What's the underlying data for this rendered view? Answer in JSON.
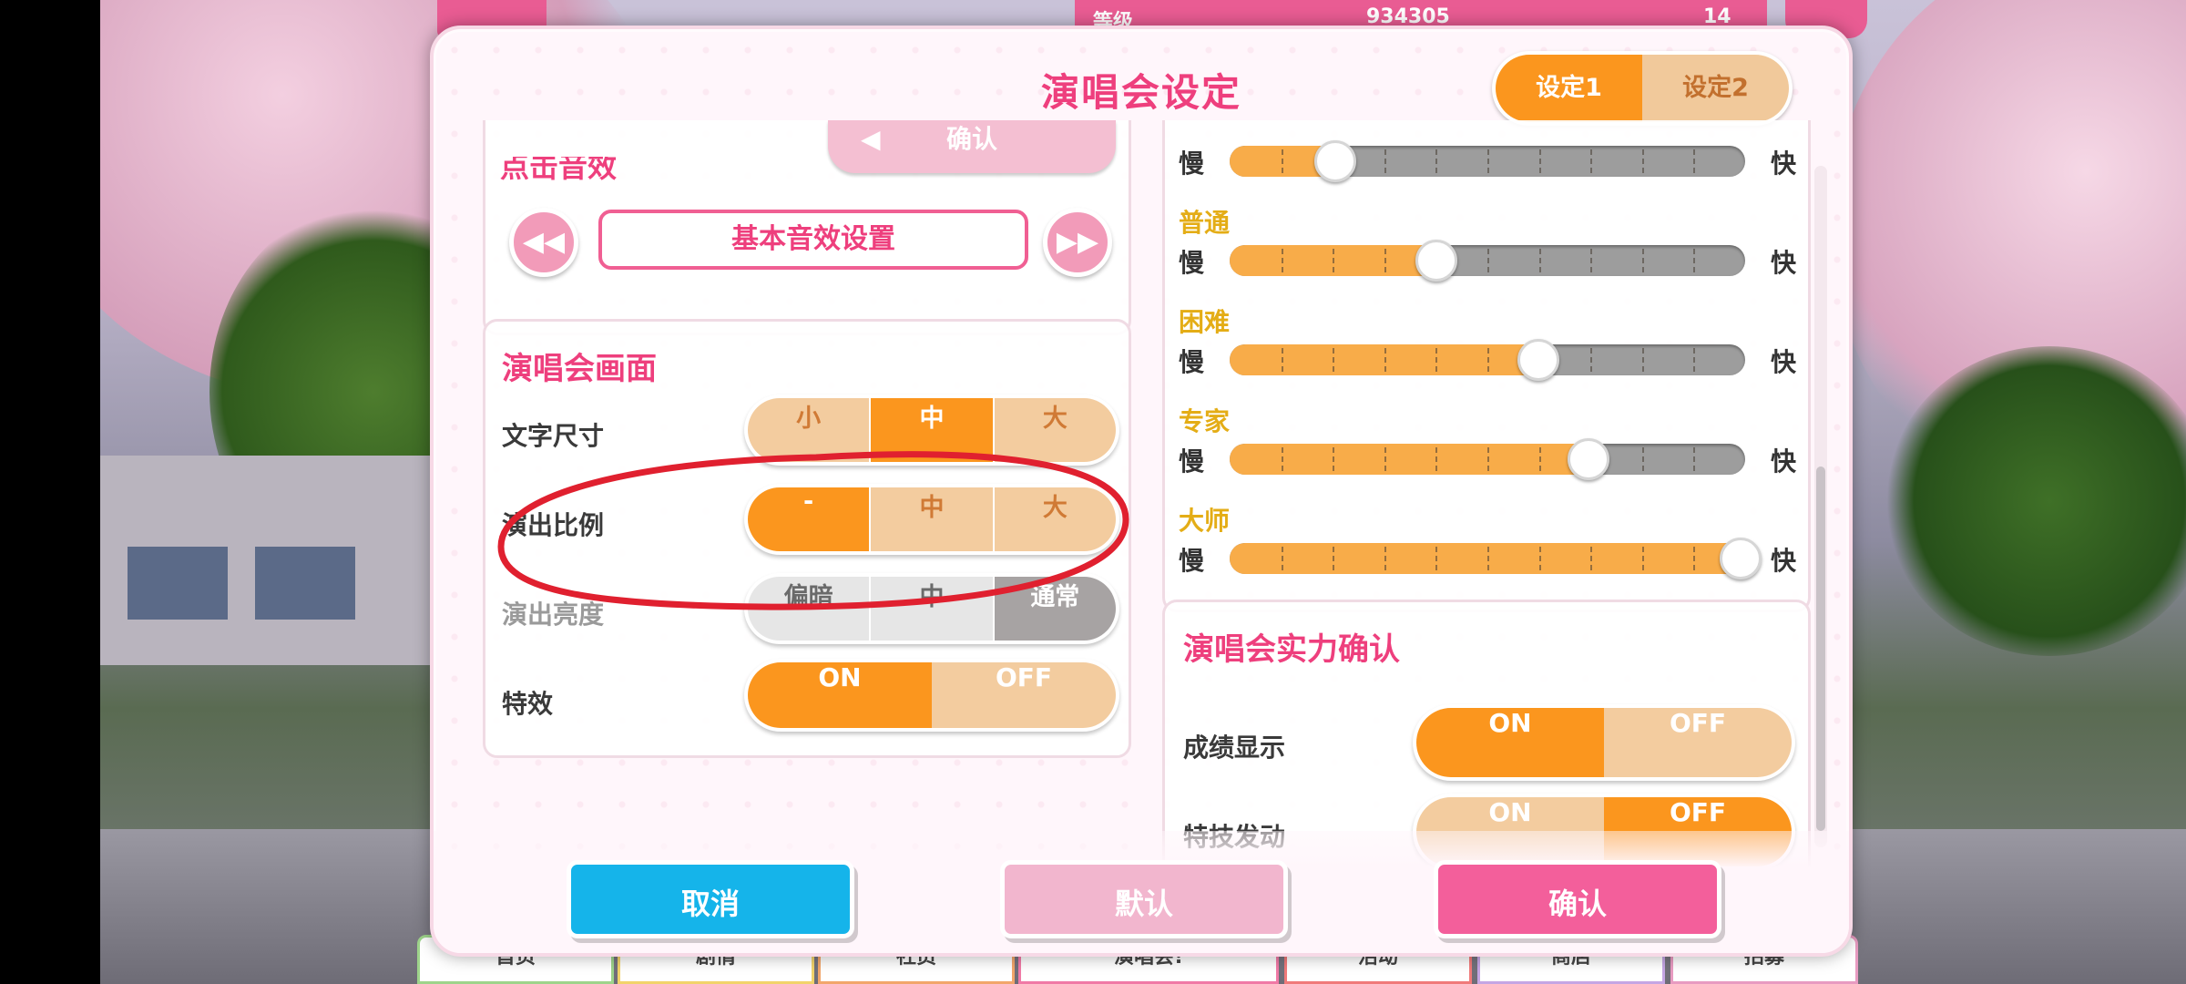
{
  "background_bar": {
    "rank_label": "等级",
    "score": "934305",
    "hearts": "14"
  },
  "bottom_tabs": [
    "首页",
    "剧情",
    "社员",
    "演唱会!",
    "活动",
    "商店",
    "招募"
  ],
  "dialog": {
    "title": "演唱会设定",
    "tabs": [
      {
        "label": "设定1",
        "selected": true
      },
      {
        "label": "设定2",
        "selected": false
      }
    ],
    "sound_section": {
      "tap_sound_label": "点击音效",
      "confirm_button": "确认",
      "basic_sound_button": "基本音效设置",
      "prev_icon": "rewind-icon",
      "next_icon": "fast-forward-icon"
    },
    "screen_section": {
      "title": "演唱会画面",
      "rows": [
        {
          "label": "文字尺寸",
          "options": [
            "小",
            "中",
            "大"
          ],
          "selected": 1,
          "style": "orange"
        },
        {
          "label": "演出比例",
          "options": [
            "-",
            "中",
            "大"
          ],
          "selected": 0,
          "style": "orange"
        },
        {
          "label": "演出亮度",
          "options": [
            "偏暗",
            "中",
            "通常"
          ],
          "selected": 2,
          "style": "gray"
        },
        {
          "label": "特效",
          "options": [
            "ON",
            "OFF"
          ],
          "selected": 0,
          "style": "orange"
        }
      ]
    },
    "speed_section": {
      "slow_label": "慢",
      "fast_label": "快",
      "sliders": [
        {
          "name": "",
          "value": 0.2
        },
        {
          "name": "普通",
          "value": 0.4
        },
        {
          "name": "困难",
          "value": 0.6
        },
        {
          "name": "专家",
          "value": 0.7
        },
        {
          "name": "大师",
          "value": 1.0
        }
      ]
    },
    "strength_section": {
      "title": "演唱会实力确认",
      "rows": [
        {
          "label": "成绩显示",
          "options": [
            "ON",
            "OFF"
          ],
          "selected": 0
        },
        {
          "label": "特技发动",
          "options": [
            "ON",
            "OFF"
          ],
          "selected": 1
        }
      ]
    },
    "buttons": {
      "cancel": "取消",
      "default": "默认",
      "confirm": "确认"
    }
  },
  "colors": {
    "accent_pink": "#ee3f7d",
    "accent_orange": "#fb961e",
    "cancel_blue": "#15b4ea",
    "confirm_pink": "#f35f9b",
    "default_pink": "#f2b6ce",
    "difficulty_gold": "#e4ad16"
  }
}
